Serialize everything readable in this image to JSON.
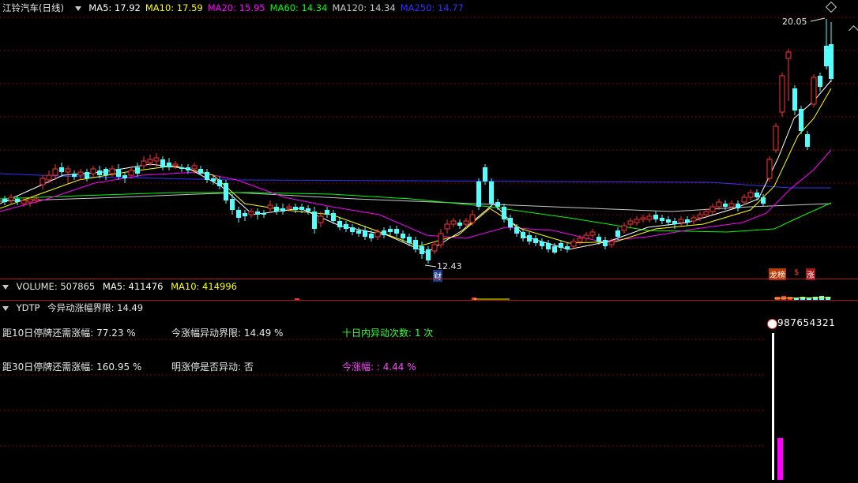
{
  "main": {
    "title": "江铃汽车(日线)",
    "ma": [
      {
        "label": "MA5: 17.92",
        "color": "#ffffff"
      },
      {
        "label": "MA10: 17.59",
        "color": "#ffff00"
      },
      {
        "label": "MA20: 15.95",
        "color": "#ff00ff"
      },
      {
        "label": "MA60: 14.34",
        "color": "#00ff00"
      },
      {
        "label": "MA120: 14.34",
        "color": "#c8c8c8"
      },
      {
        "label": "MA250: 14.77",
        "color": "#3333ff"
      }
    ],
    "high_label": "20.05",
    "low_label": "12.43",
    "markers": {
      "fin": "财",
      "rank": "龙榜",
      "sign": "$",
      "rise": "涨"
    }
  },
  "volume": {
    "label": "VOLUME: 507865",
    "ma5": "MA5: 411476",
    "ma10": "MA10: 414996"
  },
  "ydtp": {
    "title": "YDTP",
    "subtitle": "今异动涨幅界限: 14.49",
    "rows": [
      {
        "text": "距10日停牌还需涨幅: 77.23 %",
        "color": "#e6e6e6"
      },
      {
        "text": "今涨幅异动界限: 14.49 %",
        "color": "#e6e6e6"
      },
      {
        "text": "十日内异动次数: 1 次",
        "color": "#33ff33"
      },
      {
        "text": "距30日停牌还需涨幅: 160.95 %",
        "color": "#e6e6e6"
      },
      {
        "text": "明涨停是否异动: 否",
        "color": "#e6e6e6"
      },
      {
        "text": "今涨幅: : 4.44 %",
        "color": "#ff44ff"
      }
    ],
    "counter": "987654321",
    "bar_level": 0.52
  },
  "colors": {
    "up": "#ff3232",
    "down": "#54ffff",
    "grid": "#8a0000",
    "sep": "#b0121b",
    "ma5": "#ffffff",
    "ma10": "#ffff00",
    "ma20": "#ff00ff",
    "ma60": "#00ff00",
    "ma120": "#c8c8c8",
    "ma250": "#3333ff"
  }
}
